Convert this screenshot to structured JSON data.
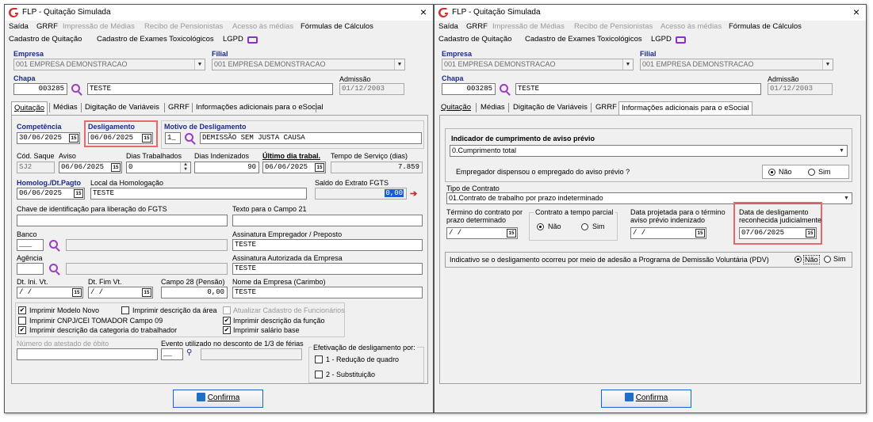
{
  "window": {
    "title": "FLP - Quitação Simulada",
    "close": "×"
  },
  "menu": {
    "row1": [
      "Saída",
      "GRRF",
      "Impressão de Médias",
      "Recibo de Pensionistas",
      "Acesso às médias",
      "Fórmulas de Cálculos"
    ],
    "row2": [
      "Cadastro de Quitação",
      "Cadastro de Exames Toxicológicos",
      "LGPD"
    ]
  },
  "header": {
    "empresa_label": "Empresa",
    "empresa": "001 EMPRESA DEMONSTRACAO",
    "filial_label": "Filial",
    "filial": "001 EMPRESA DEMONSTRACAO",
    "chapa_label": "Chapa",
    "chapa": "003285",
    "nome": "TESTE",
    "admissao_label": "Admissão",
    "admissao": "01/12/2003"
  },
  "tabs": [
    "Quitação",
    "Médias",
    "Digitação de Variáveis",
    "GRRF",
    "Informações adicionais para o eSocial"
  ],
  "quitacao": {
    "competencia_label": "Competência",
    "competencia": "30/06/2025",
    "desligamento_label": "Desligamento",
    "desligamento": "06/06/2025",
    "motivo_label": "Motivo de Desligamento",
    "motivo_code": "1_",
    "motivo": "DEMISSÃO SEM JUSTA CAUSA",
    "cod_saque_label": "Cód. Saque",
    "cod_saque": "SJ2",
    "aviso_label": "Aviso",
    "aviso": "06/06/2025",
    "dias_trab_label": "Dias Trabalhados",
    "dias_trab": "0",
    "dias_inden_label": "Dias Indenizados",
    "dias_inden": "90",
    "ultimo_dia_label": "Último dia trabal.",
    "ultimo_dia": "06/06/2025",
    "tempo_servico_label": "Tempo de Serviço (dias)",
    "tempo_servico": "7.859",
    "homolog_label": "Homolog./Dt.Pagto",
    "homolog": "06/06/2025",
    "local_label": "Local da Homologação",
    "local": "TESTE",
    "saldo_label": "Saldo do Extrato FGTS",
    "saldo": "0,00",
    "chave_label": "Chave de identificação para liberação do FGTS",
    "texto_label": "Texto para o Campo 21",
    "banco_label": "Banco",
    "assin_emp_label": "Assinatura Empregador / Preposto",
    "assin_emp": "TESTE",
    "agencia_label": "Agência",
    "assin_aut_label": "Assinatura Autorizada da Empresa",
    "assin_aut": "TESTE",
    "dt_ini_label": "Dt. Ini. Vt.",
    "dt_ini": "/ /",
    "dt_fim_label": "Dt. Fim Vt.",
    "dt_fim": "/ /",
    "campo28_label": "Campo 28 (Pensão)",
    "campo28": "0,00",
    "nome_emp_label": "Nome da Empresa (Carimbo)",
    "nome_emp": "TESTE",
    "checks": {
      "modelo_novo": "Imprimir Modelo Novo",
      "desc_area": "Imprimir descrição da área",
      "atualizar": "Atualizar Cadastro de Funcionários",
      "cnpj": "Imprimir CNPJ/CEI TOMADOR Campo 09",
      "desc_funcao": "Imprimir descrição da função",
      "desc_categoria": "Imprimir descrição da categoria do trabalhador",
      "salario_base": "Imprimir salário base"
    },
    "atestado_label": "Número do atestado de óbito",
    "evento_label": "Evento utilizado no desconto de 1/3 de férias",
    "efetivacao_label": "Efetivação de desligamento por:",
    "efet_1": "1 - Redução de quadro",
    "efet_2": "2 - Substituição"
  },
  "esocial": {
    "indicador_label": "Indicador de cumprimento de aviso prévio",
    "indicador": "0.Cumprimento total",
    "dispensou_label": "Empregador dispensou o empregado do aviso prévio ?",
    "nao": "Não",
    "sim": "Sim",
    "tipo_label": "Tipo de Contrato",
    "tipo": "01.Contrato de trabalho por prazo indeterminado",
    "termino_label_1": "Término do contrato por",
    "termino_label_2": "prazo determinado",
    "termino": "/ /",
    "tempo_parcial_label": "Contrato a tempo parcial",
    "data_proj_label_1": "Data projetada para o término",
    "data_proj_label_2": "aviso prévio indenizado",
    "data_proj": "/ /",
    "data_desl_label_1": "Data de desligamento",
    "data_desl_label_2": "reconhecida judicialmente",
    "data_desl": "07/06/2025",
    "pdv_label": "Indicativo se o desligamento ocorreu por meio de adesão a Programa de Demissão Voluntária (PDV)"
  },
  "confirm_button": "Confirma"
}
